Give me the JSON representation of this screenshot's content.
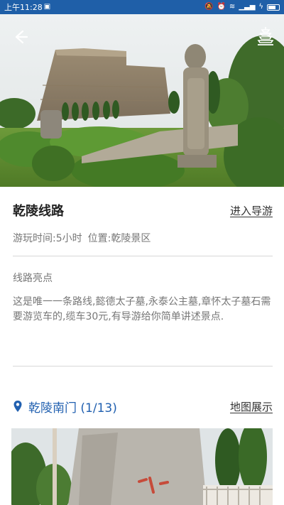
{
  "status_bar": {
    "time": "上午11:28",
    "icons": [
      "mute-icon",
      "alarm-icon",
      "wifi-icon",
      "signal-icon",
      "charging-icon",
      "battery-icon"
    ]
  },
  "hero": {
    "back_icon": "back-arrow-icon",
    "guide_icon": "pagoda-guide-icon"
  },
  "route": {
    "title": "乾陵线路",
    "enter_guide": "进入导游",
    "duration": "游玩时间:5小时",
    "location": "位置:乾陵景区",
    "highlight_label": "线路亮点",
    "highlight_text": "这是唯一一条路线,懿德太子墓,永泰公主墓,章怀太子墓石需要游览车的,缆车30元,有导游给你简单讲述景点."
  },
  "stop": {
    "icon": "location-pin-icon",
    "name": "乾陵南门 (1/13)",
    "map_show": "地图展示"
  },
  "colors": {
    "status_bar": "#1f5fa8",
    "accent_blue": "#2160b0",
    "divider": "#d8d8d8",
    "text_gray": "#777777"
  }
}
